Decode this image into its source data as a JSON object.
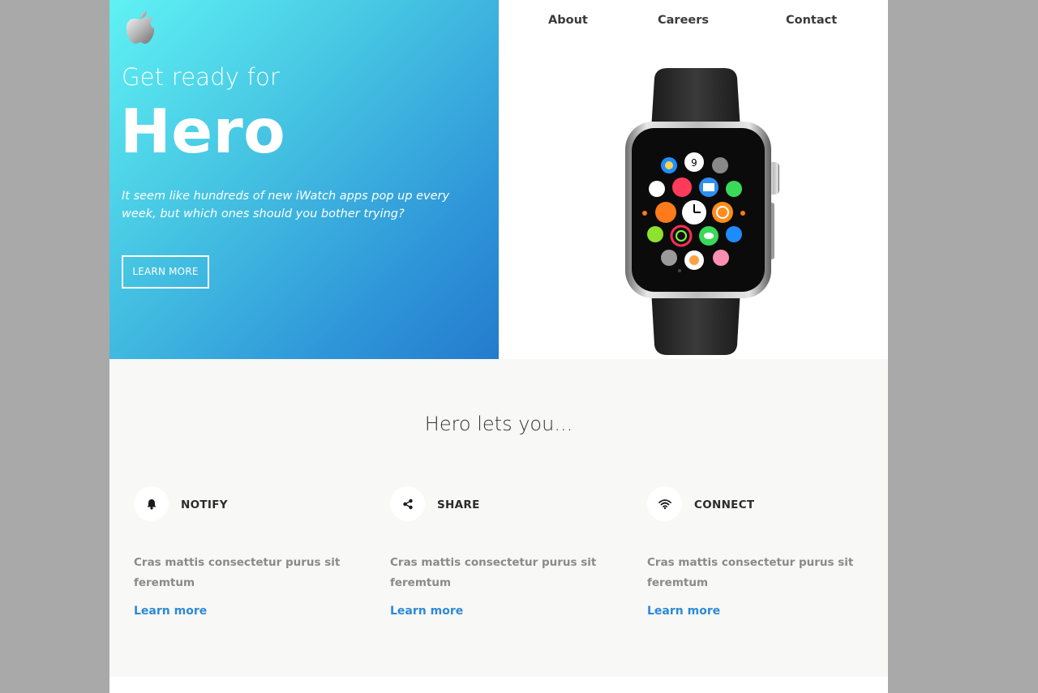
{
  "nav": {
    "about": "About",
    "careers": "Careers",
    "contact": "Contact"
  },
  "hero": {
    "pre_title": "Get ready for",
    "title": "Hero",
    "description": "It seem like hundreds of new iWatch apps pop up every week, but which ones should you bother trying?",
    "cta_label": "LEARN MORE",
    "watch_time": "9"
  },
  "features": {
    "section_title": "Hero lets you...",
    "items": [
      {
        "icon": "bell-icon",
        "title": "NOTIFY",
        "text": "Cras mattis consectetur purus sit feremtum",
        "link": "Learn more"
      },
      {
        "icon": "share-icon",
        "title": "SHARE",
        "text": "Cras mattis consectetur purus sit feremtum",
        "link": "Learn more"
      },
      {
        "icon": "wifi-icon",
        "title": "CONNECT",
        "text": "Cras mattis consectetur purus sit feremtum",
        "link": "Learn more"
      }
    ]
  },
  "colors": {
    "gradient_start": "#5ff2f4",
    "gradient_end": "#247bcd",
    "link": "#2d89d6",
    "section_bg": "#f8f8f7",
    "outer_bg": "#a9a9a9"
  }
}
